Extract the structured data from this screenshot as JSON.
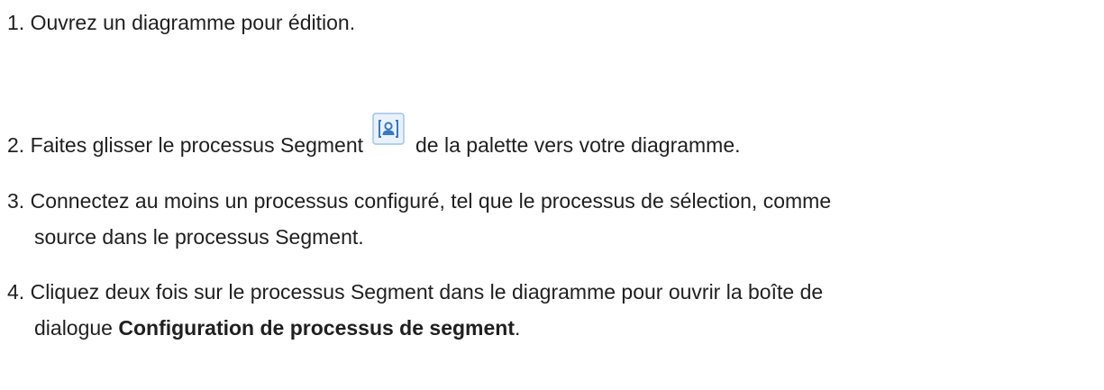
{
  "steps": [
    {
      "number": "1.",
      "text": "Ouvrez un diagramme pour édition."
    },
    {
      "number": "2.",
      "text_before": "Faites glisser le processus Segment",
      "icon": "segment-process-icon",
      "text_after": "de la palette vers votre diagramme."
    },
    {
      "number": "3.",
      "line1": "Connectez au moins un processus configuré, tel que le processus de sélection, comme",
      "line2": "source dans le processus Segment."
    },
    {
      "number": "4.",
      "line1": "Cliquez deux fois sur le processus Segment dans le diagramme pour ouvrir la boîte de",
      "line2_before": "dialogue ",
      "line2_bold": "Configuration de processus de segment",
      "line2_after": "."
    }
  ],
  "colors": {
    "text": "#1f1f1f",
    "icon_border": "#9fc3e7",
    "icon_fill": "#e9f2fb",
    "icon_glyph": "#3a78c2"
  }
}
